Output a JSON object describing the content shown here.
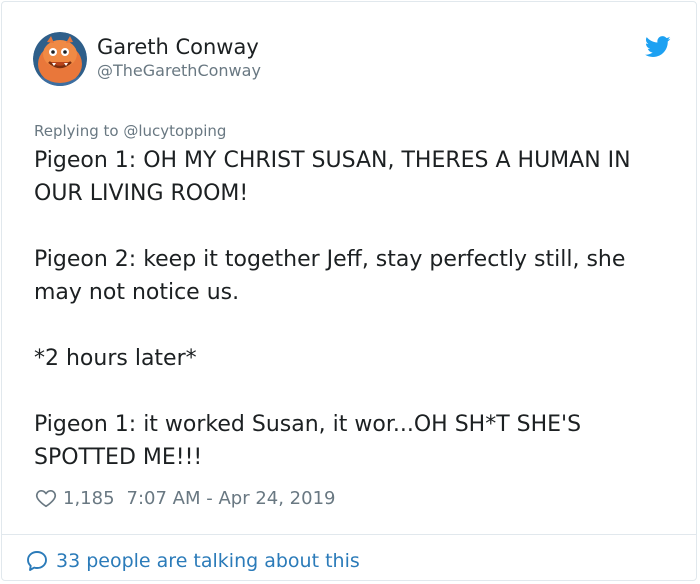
{
  "author": {
    "display_name": "Gareth Conway",
    "handle": "@TheGarethConway"
  },
  "reply": {
    "prefix": "Replying to ",
    "mention": "@lucytopping"
  },
  "tweet": {
    "paragraphs": [
      "Pigeon 1: OH MY CHRIST SUSAN, THERES A HUMAN IN OUR LIVING ROOM!",
      "Pigeon 2: keep it together Jeff, stay perfectly still, she may not notice us.",
      "*2 hours later*",
      "Pigeon 1: it worked Susan, it wor...OH SH*T SHE'S SPOTTED ME!!!"
    ]
  },
  "meta": {
    "like_count": "1,185",
    "timestamp": "7:07 AM - Apr 24, 2019"
  },
  "footer": {
    "conversation_label": "33 people are talking about this"
  },
  "icons": {
    "twitter": "twitter-bird-icon",
    "like": "heart-icon",
    "conversation": "speech-bubble-icon"
  },
  "colors": {
    "twitter_blue": "#1da1f2",
    "link_blue": "#2b7bb9",
    "secondary_text": "#697882",
    "primary_text": "#1c2022",
    "border": "#e1e8ed"
  }
}
